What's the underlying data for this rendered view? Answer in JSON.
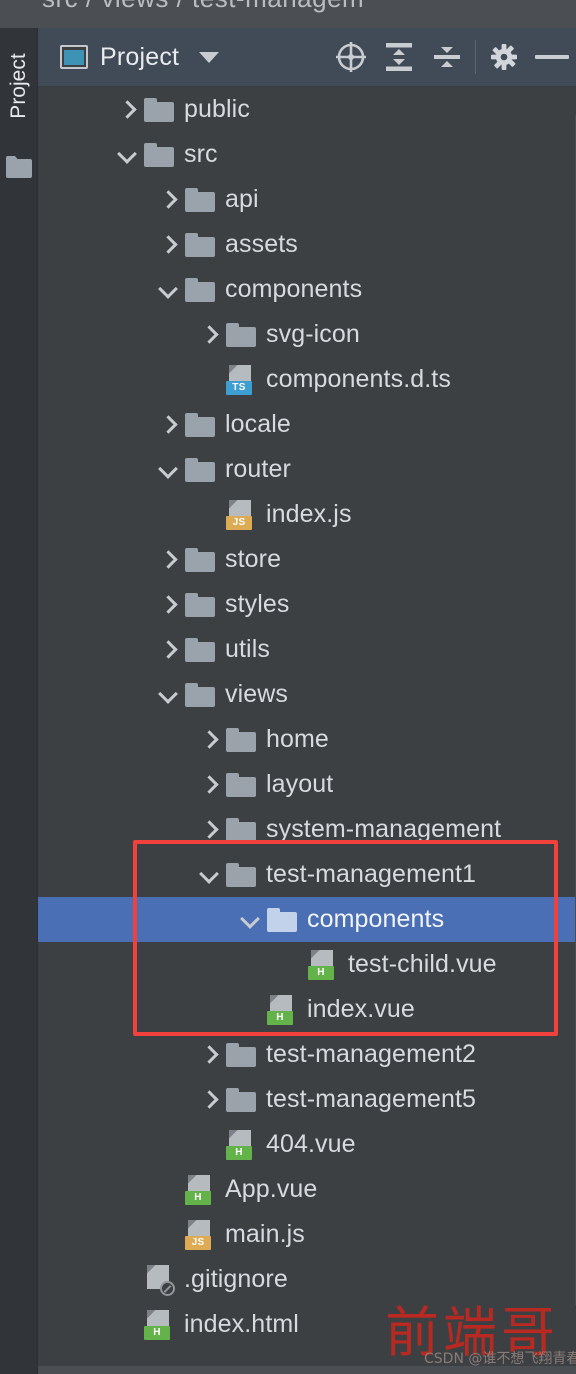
{
  "breadcrumb": {
    "text": "src  /  views  /  test-managem"
  },
  "left_strip": {
    "tab_label": "Project",
    "folder_icon": "folder-icon"
  },
  "toolbar": {
    "project_icon": "project-window-icon",
    "title": "Project",
    "chevron_icon": "chevron-down-icon",
    "locate_icon": "scroll-from-source-target-icon",
    "expand_icon": "expand-all-icon",
    "collapse_icon": "collapse-all-icon",
    "settings_icon": "gear-icon",
    "minimize_icon": "minimize-icon"
  },
  "tree": {
    "rows": [
      {
        "label": "public",
        "indent": 0,
        "twisty": "right",
        "icon": "folder",
        "selected": false
      },
      {
        "label": "src",
        "indent": 0,
        "twisty": "down",
        "icon": "folder",
        "selected": false
      },
      {
        "label": "api",
        "indent": 1,
        "twisty": "right",
        "icon": "folder",
        "selected": false
      },
      {
        "label": "assets",
        "indent": 1,
        "twisty": "right",
        "icon": "folder",
        "selected": false
      },
      {
        "label": "components",
        "indent": 1,
        "twisty": "down",
        "icon": "folder",
        "selected": false
      },
      {
        "label": "svg-icon",
        "indent": 2,
        "twisty": "right",
        "icon": "folder",
        "selected": false
      },
      {
        "label": "components.d.ts",
        "indent": 2,
        "twisty": "none",
        "icon": "file-ts",
        "badge": "TS",
        "selected": false
      },
      {
        "label": "locale",
        "indent": 1,
        "twisty": "right",
        "icon": "folder",
        "selected": false
      },
      {
        "label": "router",
        "indent": 1,
        "twisty": "down",
        "icon": "folder",
        "selected": false
      },
      {
        "label": "index.js",
        "indent": 2,
        "twisty": "none",
        "icon": "file-js",
        "badge": "JS",
        "selected": false
      },
      {
        "label": "store",
        "indent": 1,
        "twisty": "right",
        "icon": "folder",
        "selected": false
      },
      {
        "label": "styles",
        "indent": 1,
        "twisty": "right",
        "icon": "folder",
        "selected": false
      },
      {
        "label": "utils",
        "indent": 1,
        "twisty": "right",
        "icon": "folder",
        "selected": false
      },
      {
        "label": "views",
        "indent": 1,
        "twisty": "down",
        "icon": "folder",
        "selected": false
      },
      {
        "label": "home",
        "indent": 2,
        "twisty": "right",
        "icon": "folder",
        "selected": false
      },
      {
        "label": "layout",
        "indent": 2,
        "twisty": "right",
        "icon": "folder",
        "selected": false
      },
      {
        "label": "system-management",
        "indent": 2,
        "twisty": "right",
        "icon": "folder",
        "selected": false
      },
      {
        "label": "test-management1",
        "indent": 2,
        "twisty": "down",
        "icon": "folder",
        "selected": false
      },
      {
        "label": "components",
        "indent": 3,
        "twisty": "down",
        "icon": "folder",
        "selected": true
      },
      {
        "label": "test-child.vue",
        "indent": 4,
        "twisty": "none",
        "icon": "file-vue",
        "badge": "H",
        "selected": false
      },
      {
        "label": "index.vue",
        "indent": 3,
        "twisty": "none",
        "icon": "file-vue",
        "badge": "H",
        "selected": false
      },
      {
        "label": "test-management2",
        "indent": 2,
        "twisty": "right",
        "icon": "folder",
        "selected": false
      },
      {
        "label": "test-management5",
        "indent": 2,
        "twisty": "right",
        "icon": "folder",
        "selected": false
      },
      {
        "label": "404.vue",
        "indent": 2,
        "twisty": "none",
        "icon": "file-vue",
        "badge": "H",
        "selected": false
      },
      {
        "label": "App.vue",
        "indent": 1,
        "twisty": "none",
        "icon": "file-vue",
        "badge": "H",
        "selected": false
      },
      {
        "label": "main.js",
        "indent": 1,
        "twisty": "none",
        "icon": "file-js",
        "badge": "JS",
        "selected": false
      },
      {
        "label": ".gitignore",
        "indent": 0,
        "twisty": "none",
        "icon": "file-ignored",
        "badge": "",
        "selected": false
      },
      {
        "label": "index.html",
        "indent": 0,
        "twisty": "none",
        "icon": "file-vue",
        "badge": "H",
        "selected": false
      }
    ]
  },
  "annotation": {
    "highlight_color": "#f2403c",
    "selection_color": "#4a6fb5"
  },
  "watermark": {
    "main": "前端哥",
    "sub": "CSDN @谁不想飞翔青春"
  }
}
